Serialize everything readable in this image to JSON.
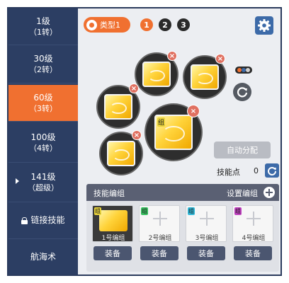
{
  "sidebar": {
    "items": [
      {
        "label": "1级",
        "sub": "（1转）"
      },
      {
        "label": "30级",
        "sub": "（2转）"
      },
      {
        "label": "60级",
        "sub": "（3转）"
      },
      {
        "label": "100级",
        "sub": "（4转）"
      },
      {
        "label": "141级",
        "sub": "（超级）"
      },
      {
        "label": "链接技能"
      },
      {
        "label": "航海术"
      }
    ],
    "active_index": 2
  },
  "topbar": {
    "type_label": "类型1",
    "pages": [
      "1",
      "2",
      "3"
    ],
    "active_page": "1"
  },
  "skills": {
    "remove_symbol": "×",
    "group_mark": "组"
  },
  "auto_assign_label": "自动分配",
  "skill_points": {
    "label": "技能点",
    "value": "0"
  },
  "edit_panel": {
    "title": "技能编组",
    "set_label": "设置编组",
    "groups": [
      {
        "name": "1号编组",
        "mark": "组",
        "equip": "装备"
      },
      {
        "name": "2号编组",
        "mark": "组",
        "equip": "装备"
      },
      {
        "name": "3号编组",
        "mark": "组",
        "equip": "装备"
      },
      {
        "name": "4号编组",
        "mark": "组",
        "equip": "装备"
      }
    ]
  },
  "colors": {
    "accent": "#f07030",
    "sidebar_bg": "#2c3e63",
    "button_blue": "#3c6aa8",
    "group_mark_colors": [
      "#e8d23a",
      "#38c060",
      "#30b8d8",
      "#c040c0"
    ]
  }
}
